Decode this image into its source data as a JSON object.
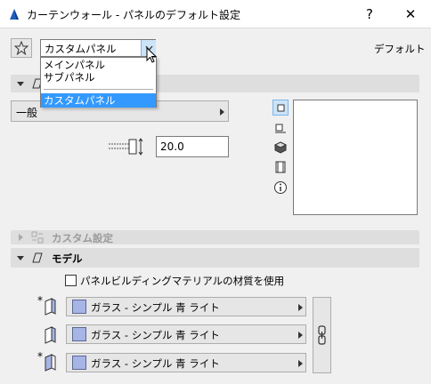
{
  "window": {
    "title": "カーテンウォール - パネルのデフォルト設定",
    "help_label": "?",
    "close_label": "✕"
  },
  "toolbar": {
    "selected_preset": "カスタムパネル",
    "default_label": "デフォルト"
  },
  "preset_dropdown": {
    "options": [
      "メインパネル",
      "サブパネル",
      "カスタムパネル"
    ],
    "selected_index": 2
  },
  "general": {
    "category_label": "一般",
    "thickness_value": "20.0"
  },
  "sections": {
    "custom_settings": "カスタム設定",
    "model": "モデル"
  },
  "model": {
    "use_material_label": "パネルビルディングマテリアルの材質を使用",
    "use_material_checked": false,
    "surfaces": [
      {
        "label": "ガラス - シンプル 青 ライト",
        "color": "#a6b4e6"
      },
      {
        "label": "ガラス - シンプル 青 ライト",
        "color": "#a6b4e6"
      },
      {
        "label": "ガラス - シンプル 青 ライト",
        "color": "#a6b4e6"
      }
    ]
  },
  "colors": {
    "accent": "#3399ff",
    "swatch": "#a6b4e6"
  }
}
